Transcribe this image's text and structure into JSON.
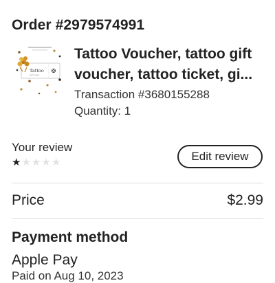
{
  "order": {
    "title": "Order #2979574991"
  },
  "item": {
    "title_line1": "Tattoo Voucher, tattoo gift",
    "title_line2": "voucher, tattoo ticket, gi...",
    "transaction": "Transaction #3680155288",
    "quantity": "Quantity: 1",
    "thumbnail": {
      "ticket_text": "Tattoo",
      "ticket_subtext": "GIFT CARD"
    }
  },
  "review": {
    "label": "Your review",
    "rating": 1,
    "max_rating": 5,
    "edit_label": "Edit review"
  },
  "price": {
    "label": "Price",
    "value": "$2.99"
  },
  "payment": {
    "heading": "Payment method",
    "method": "Apple Pay",
    "date_partial": "Paid on Aug 10, 2023"
  }
}
